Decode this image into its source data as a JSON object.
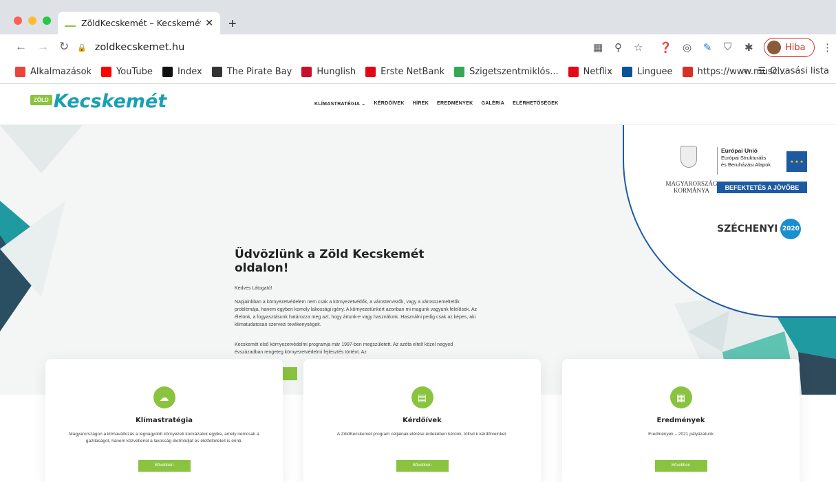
{
  "browser": {
    "tab_title": "ZöldKecskemét – Kecskemét ö",
    "tab_close": "✕",
    "new_tab": "+",
    "url": "zoldkecskemet.hu",
    "profile_label": "Hiba",
    "bookmarks": [
      {
        "label": "Alkalmazások",
        "color": "#e8453c"
      },
      {
        "label": "YouTube",
        "color": "#ff0000"
      },
      {
        "label": "Index",
        "color": "#111111"
      },
      {
        "label": "The Pirate Bay",
        "color": "#333333"
      },
      {
        "label": "Hunglish",
        "color": "#c8102e"
      },
      {
        "label": "Erste NetBank",
        "color": "#e30613"
      },
      {
        "label": "Szigetszentmiklós...",
        "color": "#34a853"
      },
      {
        "label": "Netflix",
        "color": "#e50914"
      },
      {
        "label": "Linguee",
        "color": "#0b5394"
      },
      {
        "label": "https://www.musc...",
        "color": "#d93025"
      }
    ],
    "bookmarks_overflow": "»",
    "reading_list": "Olvasási lista"
  },
  "site": {
    "logo_badge": "ZÖLD",
    "logo_text": "Kecskemét",
    "nav": [
      "KLÍMASTRATÉGIA ⌄",
      "KÉRDŐÍVEK",
      "HÍREK",
      "EREDMÉNYEK",
      "GALÉRIA",
      "ELÉRHETŐSÉGEK"
    ],
    "hero": {
      "title": "Üdvözlünk a Zöld Kecskemét oldalon!",
      "greeting": "Kedves Látogató!",
      "para1": "Napjainkban a környezetvédelem nem csak a környezetvédők, a várostervezők, vagy a városüzemeltetők problémája, hanem egyben komoly lakossági igény. A környezetünkért azonban mi magunk vagyunk felelősek. Az életünk, a fogyasztásunk határozza meg azt, hogy ártunk-e vagy használunk. Használni pedig csak az képes, aki klímatudatosan szervezi tevékenységeit.",
      "para2": "Kecskemét első környezetvédelmi programja már 1997-ben megszületett. Az azóta eltelt közel negyed évszázadban rengeteg környezetvédelmi fejlesztés történt. Az",
      "more_button": "^ Tovább olvasom"
    },
    "eu": {
      "gov_line1": "MAGYARORSZÁG",
      "gov_line2": "KORMÁNYA",
      "eu_title": "Európai Unió",
      "eu_line1": "Európai Strukturális",
      "eu_line2": "és Beruházási Alapok",
      "invest": "BEFEKTETÉS A JÖVŐBE",
      "szechenyi": "SZÉCHENYI",
      "year": "2020"
    },
    "cards": [
      {
        "title": "Klímastratégia",
        "text": "Magyarországon a klímaváltozás a legnagyobb környezeti kockázatok egyike, amely nemcsak a gazdaságot, hanem közvetlenül a lakosság életmódját és életfeltételeit is érinti.",
        "button": "Bővebben",
        "icon": "☁"
      },
      {
        "title": "Kérdőívek",
        "text": "A ZöldKecskemét program céljainak elérése érdekében kérünk, töltsd k kérdőíveinket.",
        "button": "Bővebben",
        "icon": "▤"
      },
      {
        "title": "Eredmények",
        "text": "Eredmények – 2021 pályázatunk",
        "button": "Bővebben",
        "icon": "▦"
      }
    ]
  },
  "colors": {
    "brand_green": "#8ac33f",
    "brand_teal": "#1aa0b5",
    "eu_blue": "#1d5aa3"
  }
}
